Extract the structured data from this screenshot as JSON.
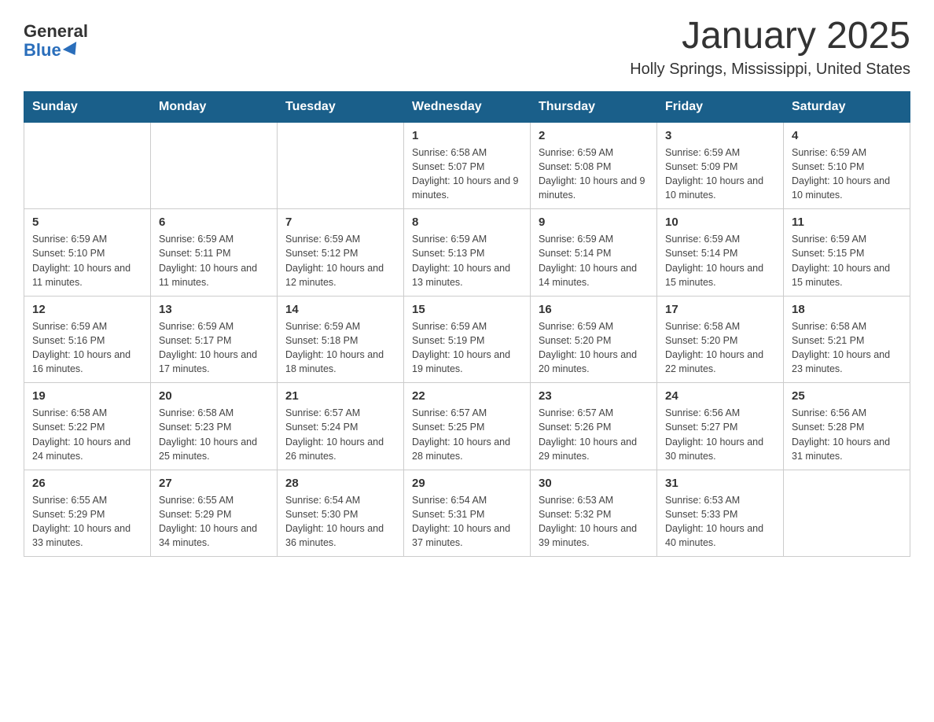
{
  "logo": {
    "general": "General",
    "blue": "Blue"
  },
  "header": {
    "month": "January 2025",
    "location": "Holly Springs, Mississippi, United States"
  },
  "weekdays": [
    "Sunday",
    "Monday",
    "Tuesday",
    "Wednesday",
    "Thursday",
    "Friday",
    "Saturday"
  ],
  "weeks": [
    [
      {
        "day": "",
        "info": ""
      },
      {
        "day": "",
        "info": ""
      },
      {
        "day": "",
        "info": ""
      },
      {
        "day": "1",
        "info": "Sunrise: 6:58 AM\nSunset: 5:07 PM\nDaylight: 10 hours and 9 minutes."
      },
      {
        "day": "2",
        "info": "Sunrise: 6:59 AM\nSunset: 5:08 PM\nDaylight: 10 hours and 9 minutes."
      },
      {
        "day": "3",
        "info": "Sunrise: 6:59 AM\nSunset: 5:09 PM\nDaylight: 10 hours and 10 minutes."
      },
      {
        "day": "4",
        "info": "Sunrise: 6:59 AM\nSunset: 5:10 PM\nDaylight: 10 hours and 10 minutes."
      }
    ],
    [
      {
        "day": "5",
        "info": "Sunrise: 6:59 AM\nSunset: 5:10 PM\nDaylight: 10 hours and 11 minutes."
      },
      {
        "day": "6",
        "info": "Sunrise: 6:59 AM\nSunset: 5:11 PM\nDaylight: 10 hours and 11 minutes."
      },
      {
        "day": "7",
        "info": "Sunrise: 6:59 AM\nSunset: 5:12 PM\nDaylight: 10 hours and 12 minutes."
      },
      {
        "day": "8",
        "info": "Sunrise: 6:59 AM\nSunset: 5:13 PM\nDaylight: 10 hours and 13 minutes."
      },
      {
        "day": "9",
        "info": "Sunrise: 6:59 AM\nSunset: 5:14 PM\nDaylight: 10 hours and 14 minutes."
      },
      {
        "day": "10",
        "info": "Sunrise: 6:59 AM\nSunset: 5:14 PM\nDaylight: 10 hours and 15 minutes."
      },
      {
        "day": "11",
        "info": "Sunrise: 6:59 AM\nSunset: 5:15 PM\nDaylight: 10 hours and 15 minutes."
      }
    ],
    [
      {
        "day": "12",
        "info": "Sunrise: 6:59 AM\nSunset: 5:16 PM\nDaylight: 10 hours and 16 minutes."
      },
      {
        "day": "13",
        "info": "Sunrise: 6:59 AM\nSunset: 5:17 PM\nDaylight: 10 hours and 17 minutes."
      },
      {
        "day": "14",
        "info": "Sunrise: 6:59 AM\nSunset: 5:18 PM\nDaylight: 10 hours and 18 minutes."
      },
      {
        "day": "15",
        "info": "Sunrise: 6:59 AM\nSunset: 5:19 PM\nDaylight: 10 hours and 19 minutes."
      },
      {
        "day": "16",
        "info": "Sunrise: 6:59 AM\nSunset: 5:20 PM\nDaylight: 10 hours and 20 minutes."
      },
      {
        "day": "17",
        "info": "Sunrise: 6:58 AM\nSunset: 5:20 PM\nDaylight: 10 hours and 22 minutes."
      },
      {
        "day": "18",
        "info": "Sunrise: 6:58 AM\nSunset: 5:21 PM\nDaylight: 10 hours and 23 minutes."
      }
    ],
    [
      {
        "day": "19",
        "info": "Sunrise: 6:58 AM\nSunset: 5:22 PM\nDaylight: 10 hours and 24 minutes."
      },
      {
        "day": "20",
        "info": "Sunrise: 6:58 AM\nSunset: 5:23 PM\nDaylight: 10 hours and 25 minutes."
      },
      {
        "day": "21",
        "info": "Sunrise: 6:57 AM\nSunset: 5:24 PM\nDaylight: 10 hours and 26 minutes."
      },
      {
        "day": "22",
        "info": "Sunrise: 6:57 AM\nSunset: 5:25 PM\nDaylight: 10 hours and 28 minutes."
      },
      {
        "day": "23",
        "info": "Sunrise: 6:57 AM\nSunset: 5:26 PM\nDaylight: 10 hours and 29 minutes."
      },
      {
        "day": "24",
        "info": "Sunrise: 6:56 AM\nSunset: 5:27 PM\nDaylight: 10 hours and 30 minutes."
      },
      {
        "day": "25",
        "info": "Sunrise: 6:56 AM\nSunset: 5:28 PM\nDaylight: 10 hours and 31 minutes."
      }
    ],
    [
      {
        "day": "26",
        "info": "Sunrise: 6:55 AM\nSunset: 5:29 PM\nDaylight: 10 hours and 33 minutes."
      },
      {
        "day": "27",
        "info": "Sunrise: 6:55 AM\nSunset: 5:29 PM\nDaylight: 10 hours and 34 minutes."
      },
      {
        "day": "28",
        "info": "Sunrise: 6:54 AM\nSunset: 5:30 PM\nDaylight: 10 hours and 36 minutes."
      },
      {
        "day": "29",
        "info": "Sunrise: 6:54 AM\nSunset: 5:31 PM\nDaylight: 10 hours and 37 minutes."
      },
      {
        "day": "30",
        "info": "Sunrise: 6:53 AM\nSunset: 5:32 PM\nDaylight: 10 hours and 39 minutes."
      },
      {
        "day": "31",
        "info": "Sunrise: 6:53 AM\nSunset: 5:33 PM\nDaylight: 10 hours and 40 minutes."
      },
      {
        "day": "",
        "info": ""
      }
    ]
  ]
}
